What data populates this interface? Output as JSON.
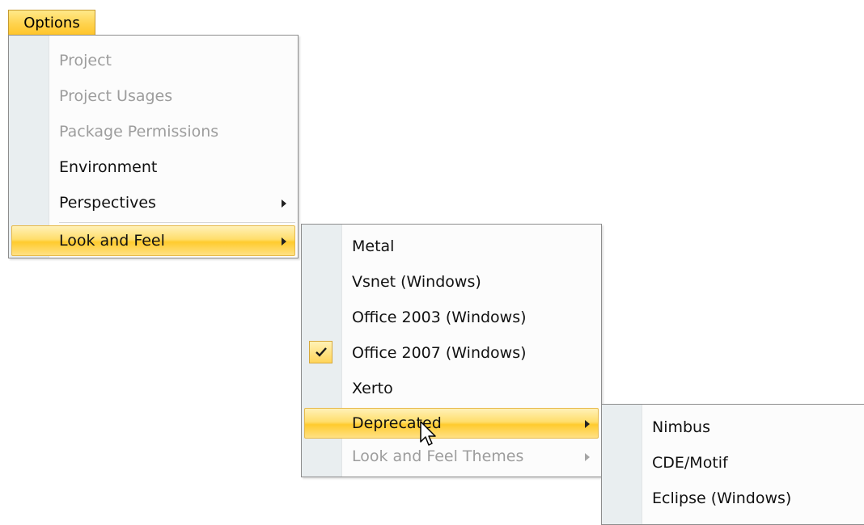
{
  "menubar": {
    "options_label": "Options"
  },
  "options_menu": {
    "items": [
      {
        "label": "Project",
        "disabled": true
      },
      {
        "label": "Project Usages",
        "disabled": true
      },
      {
        "label": "Package Permissions",
        "disabled": true
      },
      {
        "label": "Environment",
        "disabled": false
      },
      {
        "label": "Perspectives",
        "disabled": false,
        "has_submenu": true
      },
      {
        "label": "Look and Feel",
        "disabled": false,
        "has_submenu": true,
        "highlighted": true
      }
    ]
  },
  "look_and_feel_menu": {
    "items": [
      {
        "label": "Metal"
      },
      {
        "label": "Vsnet (Windows)"
      },
      {
        "label": "Office 2003 (Windows)"
      },
      {
        "label": "Office 2007 (Windows)",
        "checked": true
      },
      {
        "label": "Xerto"
      },
      {
        "label": "Deprecated",
        "has_submenu": true,
        "highlighted": true
      },
      {
        "label": "Look and Feel Themes",
        "has_submenu": true,
        "disabled": true
      }
    ]
  },
  "deprecated_menu": {
    "items": [
      {
        "label": "Nimbus"
      },
      {
        "label": "CDE/Motif"
      },
      {
        "label": "Eclipse (Windows)"
      }
    ]
  },
  "colors": {
    "highlight": "#ffd34e",
    "gutter": "#e9eef0",
    "disabled_text": "#9d9d9d",
    "border": "#8d8d8d"
  }
}
